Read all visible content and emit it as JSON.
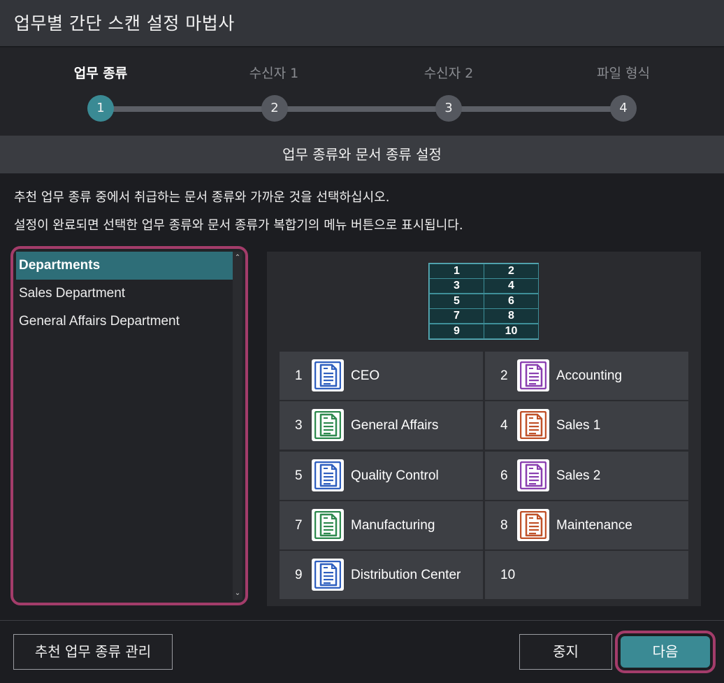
{
  "window": {
    "title": "업무별 간단 스캔 설정 마법사"
  },
  "steps": [
    {
      "label": "업무 종류",
      "number": "1",
      "active": true
    },
    {
      "label": "수신자 1",
      "number": "2",
      "active": false
    },
    {
      "label": "수신자 2",
      "number": "3",
      "active": false
    },
    {
      "label": "파일 형식",
      "number": "4",
      "active": false
    }
  ],
  "section": {
    "header": "업무 종류와 문서 종류 설정"
  },
  "description": {
    "line1": "추천 업무 종류 중에서 취급하는 문서 종류와 가까운 것을 선택하십시오.",
    "line2": "설정이 완료되면 선택한 업무 종류와 문서 종류가 복합기의 메뉴 버튼으로 표시됩니다."
  },
  "list": {
    "items": [
      "Departments",
      "Sales Department",
      "General Affairs Department"
    ],
    "selected_index": 0
  },
  "mini_grid": [
    "1",
    "2",
    "3",
    "4",
    "5",
    "6",
    "7",
    "8",
    "9",
    "10"
  ],
  "tiles": [
    {
      "number": "1",
      "name": "CEO",
      "color": "#2f5fbf"
    },
    {
      "number": "2",
      "name": "Accounting",
      "color": "#8a3fb0"
    },
    {
      "number": "3",
      "name": "General Affairs",
      "color": "#2f8a4f"
    },
    {
      "number": "4",
      "name": "Sales 1",
      "color": "#c0522a"
    },
    {
      "number": "5",
      "name": "Quality Control",
      "color": "#2f5fbf"
    },
    {
      "number": "6",
      "name": "Sales 2",
      "color": "#8a3fb0"
    },
    {
      "number": "7",
      "name": "Manufacturing",
      "color": "#2f8a4f"
    },
    {
      "number": "8",
      "name": "Maintenance",
      "color": "#c0522a"
    },
    {
      "number": "9",
      "name": "Distribution Center",
      "color": "#2f5fbf"
    },
    {
      "number": "10",
      "name": "",
      "color": ""
    }
  ],
  "buttons": {
    "manage": "추천 업무 종류 관리",
    "cancel": "중지",
    "next": "다음"
  },
  "colors": {
    "accent": "#3a8a94",
    "highlight_border": "#a33c6a"
  }
}
